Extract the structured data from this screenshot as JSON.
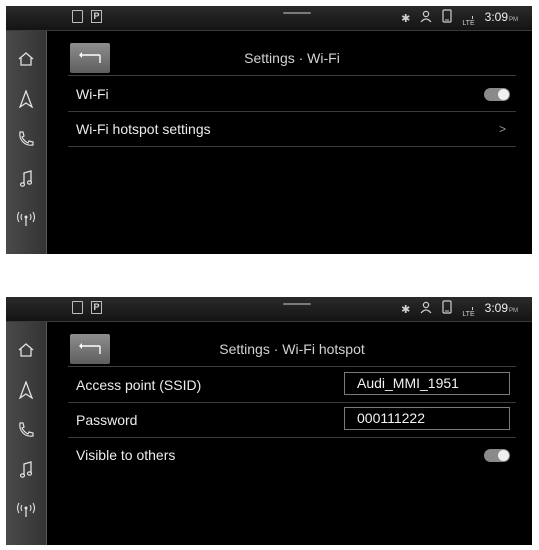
{
  "status_bar": {
    "left_icons": [
      "phone-mirror-icon",
      "parking-icon"
    ],
    "parking_label": "P",
    "right_icons": [
      "bluetooth-icon",
      "user-icon",
      "phone-icon",
      "lte-signal-icon"
    ],
    "lte_label": "LTE",
    "time": "3:09",
    "ampm": "PM"
  },
  "sidebar": {
    "items": [
      "home-icon",
      "navigation-icon",
      "phone-icon",
      "music-icon",
      "radio-icon"
    ]
  },
  "screen1": {
    "title": "Settings · Wi-Fi",
    "rows": [
      {
        "label": "Wi-Fi",
        "control": "toggle",
        "on": true
      },
      {
        "label": "Wi-Fi hotspot settings",
        "control": "chevron",
        "chevron": ">"
      }
    ]
  },
  "screen2": {
    "title": "Settings · Wi-Fi hotspot",
    "rows": [
      {
        "label": "Access point (SSID)",
        "value": "Audi_MMI_1951"
      },
      {
        "label": "Password",
        "value": "000111222"
      },
      {
        "label": "Visible to others",
        "control": "toggle",
        "on": true
      }
    ]
  },
  "colors": {
    "screen_bg": "#000000",
    "text": "#ececec",
    "toggle": "#8a8a8a"
  }
}
